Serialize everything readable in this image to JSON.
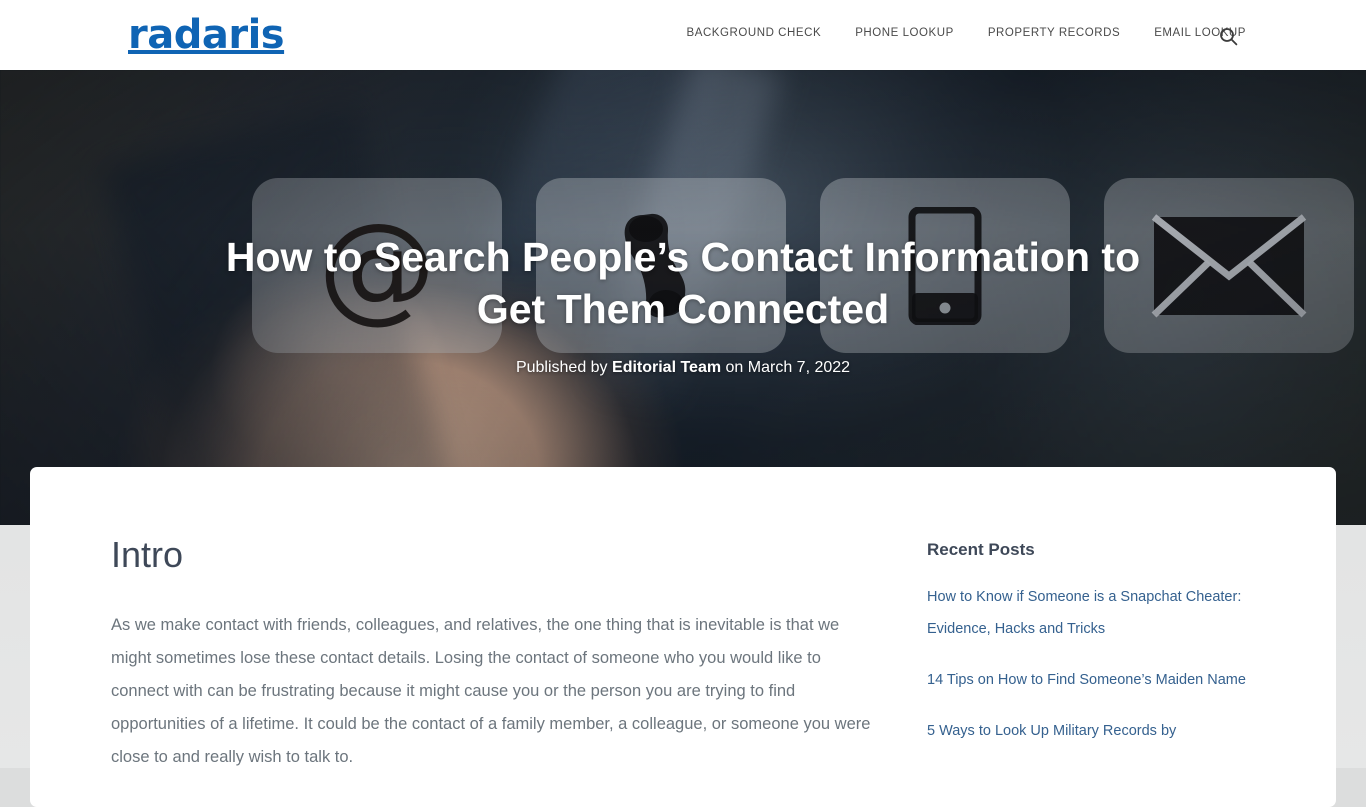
{
  "header": {
    "logo_text": "radaris",
    "logo_color": "#0f64b4",
    "nav": [
      {
        "label": "BACKGROUND CHECK"
      },
      {
        "label": "PHONE LOOKUP"
      },
      {
        "label": "PROPERTY RECORDS"
      },
      {
        "label": "EMAIL LOOKUP"
      }
    ],
    "search_icon": "search-icon"
  },
  "hero": {
    "title": "How to Search People’s Contact Information to Get Them Connected",
    "meta_prefix": "Published by",
    "meta_author": "Editorial Team",
    "meta_middle": "on",
    "meta_date": "March 7, 2022",
    "tiles": [
      {
        "icon": "at-sign-icon"
      },
      {
        "icon": "phone-handset-icon"
      },
      {
        "icon": "smartphone-icon"
      },
      {
        "icon": "envelope-icon"
      }
    ]
  },
  "article": {
    "heading": "Intro",
    "paragraph": "As we make contact with friends, colleagues, and relatives, the one thing that is inevitable is that we might sometimes lose these contact details. Losing the contact of someone who you would like to connect with can be frustrating because it might cause you or the person you are trying to find opportunities of a lifetime. It could be the contact of a family member, a colleague, or someone you were close to and really wish to talk to."
  },
  "sidebar": {
    "heading": "Recent Posts",
    "posts": [
      {
        "title": "How to Know if Someone is a Snapchat Cheater: Evidence, Hacks and Tricks"
      },
      {
        "title": "14 Tips on How to Find Someone’s Maiden Name"
      },
      {
        "title": "5 Ways to Look Up Military Records by"
      }
    ]
  },
  "theme": {
    "brand_blue": "#0f64b4",
    "link_blue": "#35618f",
    "heading_slate": "#3e4858",
    "body_gray": "#6c757d",
    "page_bg": "#dcdddd"
  }
}
